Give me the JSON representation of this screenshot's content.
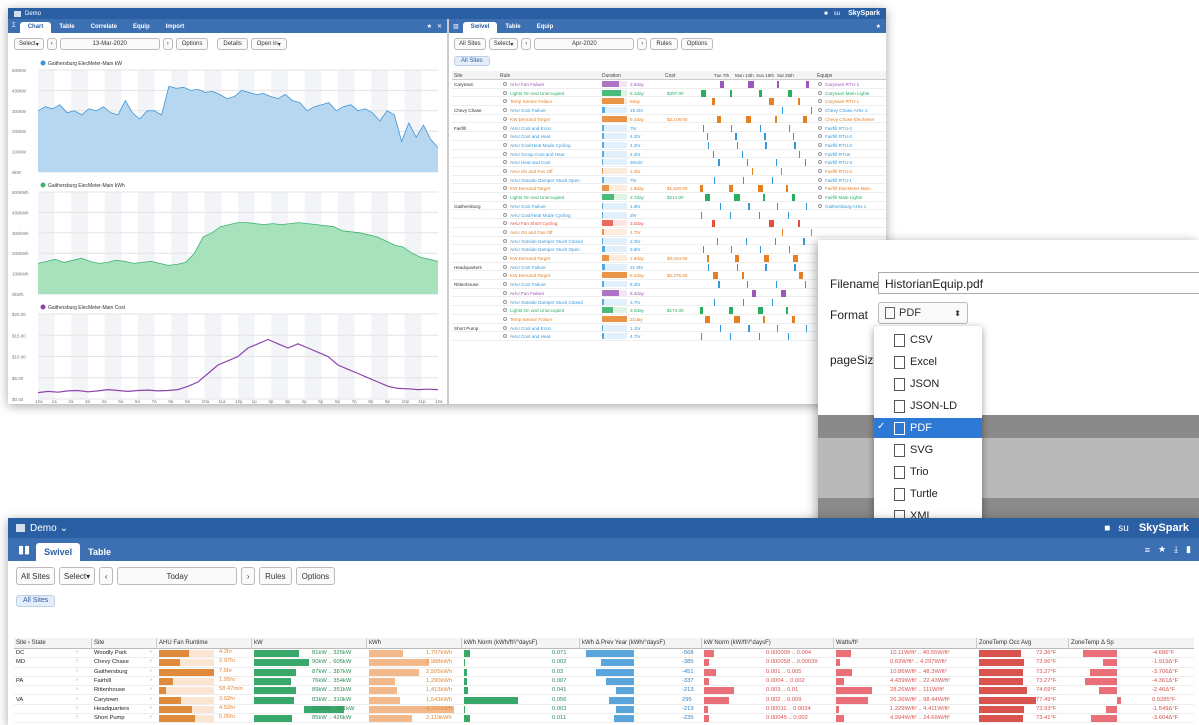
{
  "top": {
    "app_title": "Demo",
    "user": "su",
    "brand": "SkySpark",
    "left_tabs": [
      "Chart",
      "Table",
      "Correlate",
      "Equip",
      "Import"
    ],
    "left_toolbar": {
      "select": "Select",
      "date": "13-Mar-2020",
      "options": "Options",
      "details": "Details",
      "open_in": "Open in"
    },
    "charts": [
      {
        "title": "Gaithersburg ElecMeter-Main kW",
        "color": "#3f95d6",
        "fill": "#b7d6ef",
        "ticks": [
          "500kW",
          "400kW",
          "300kW",
          "200kW",
          "100kW",
          "0kW"
        ],
        "values": [
          300,
          320,
          310,
          330,
          290,
          300,
          280,
          310,
          300,
          320,
          290,
          280,
          350,
          290,
          260,
          300,
          300,
          280,
          420,
          410,
          415,
          400,
          405,
          390,
          395,
          380,
          360,
          370,
          400,
          390,
          380,
          385,
          370,
          360,
          380,
          350,
          340,
          300,
          320,
          330,
          340,
          300,
          320,
          330,
          300,
          310,
          290,
          250,
          300,
          280,
          150,
          240,
          170,
          230,
          160,
          120
        ],
        "max": 500
      },
      {
        "title": "Gaithersburg ElecMeter-Main kWh",
        "color": "#3cb371",
        "fill": "#a8e2bd",
        "ticks": [
          "500kWh",
          "400kWh",
          "300kWh",
          "200kWh",
          "100kWh",
          "0kWh"
        ],
        "values": [
          150,
          160,
          170,
          155,
          165,
          175,
          160,
          150,
          155,
          165,
          160,
          150,
          155,
          160,
          150,
          140,
          145,
          155,
          200,
          280,
          300,
          330,
          340,
          350,
          350,
          345,
          340,
          345,
          340,
          345,
          350,
          345,
          340,
          335,
          330,
          310,
          305,
          300,
          290,
          280,
          260,
          240,
          230,
          200,
          180,
          170,
          160
        ],
        "max": 500
      },
      {
        "title": "Gaithersburg ElecMeter-Main Cost",
        "color": "#8e44ad",
        "fill": "none",
        "ticks": [
          "$20.00",
          "$15.00",
          "$10.00",
          "$5.00",
          "$0.00"
        ],
        "values": [
          1.5,
          1.8,
          1.6,
          1.9,
          2,
          1.7,
          1.9,
          2.2,
          2,
          1.8,
          2,
          2.1,
          1.9,
          2,
          2.2,
          3,
          4,
          6,
          8,
          9,
          10,
          12,
          13,
          14,
          13,
          12,
          13,
          12,
          11,
          10,
          8,
          7,
          6,
          5,
          4,
          3,
          2.5,
          2.4,
          2.2,
          2.3,
          2.2
        ],
        "max": 20
      }
    ],
    "x_ticks": [
      "12a",
      "1a",
      "2a",
      "3a",
      "4a",
      "5a",
      "6a",
      "7a",
      "8a",
      "9a",
      "10a",
      "11a",
      "12p",
      "1p",
      "2p",
      "3p",
      "4p",
      "5p",
      "6p",
      "7p",
      "8p",
      "9p",
      "10p",
      "11p",
      "12a"
    ],
    "right_tabs": [
      "Swivel",
      "Table",
      "Equip"
    ],
    "right_toolbar": {
      "all_sites": "All Sites",
      "select": "Select",
      "date": "Apr-2020",
      "rules": "Rules",
      "options": "Options",
      "chip": "All Sites"
    },
    "rule_headers": [
      "Site",
      "Rule",
      "Duration",
      "Cost",
      "Equips"
    ],
    "timeline_headers": [
      "Tue 7th",
      "Mon 13th",
      "Sun 19th",
      "Sat 25th"
    ],
    "rules": [
      {
        "site": "Carytown",
        "rule": "AHU Fan Failure",
        "dur": "3.8day",
        "cost": "",
        "equip": "Carytown RTU-1",
        "c": "#9b59b6"
      },
      {
        "site": "",
        "rule": "Lights On and Unoccupied",
        "dur": "5.1day",
        "cost": "$397.00",
        "equip": "Carytown Main Lights",
        "c": "#27ae60"
      },
      {
        "site": "",
        "rule": "Temp Sensor Failure",
        "dur": "8day",
        "cost": "",
        "equip": "Carytown RTU-1",
        "c": "#e67e22"
      },
      {
        "site": "Chevy Chase",
        "rule": "AHU Cool Failure",
        "dur": "19.2hr",
        "cost": "",
        "equip": "Chevy Chase AHU-1",
        "c": "#3498db"
      },
      {
        "site": "",
        "rule": "KW Demand Target",
        "dur": "9.4day",
        "cost": "$2,108.00",
        "equip": "Chevy Chase ElecMeter",
        "c": "#e67e22"
      },
      {
        "site": "Fairfill",
        "rule": "AHU Cool and Econ",
        "dur": "7hr",
        "cost": "",
        "equip": "Fairfill RTU-3",
        "c": "#3498db"
      },
      {
        "site": "",
        "rule": "AHU Cool and Heat",
        "dur": "4.2hr",
        "cost": "",
        "equip": "Fairfill RTU-2",
        "c": "#3498db"
      },
      {
        "site": "",
        "rule": "AHU Cool/Heat Mode Cycling",
        "dur": "4.2hr",
        "cost": "",
        "equip": "Fairfill RTU-2",
        "c": "#3498db"
      },
      {
        "site": "",
        "rule": "AHU Group Cool and Heat",
        "dur": "4.2hr",
        "cost": "",
        "equip": "Fairfill RTUs",
        "c": "#3498db"
      },
      {
        "site": "",
        "rule": "AHU Heat and Cool",
        "dur": "30min",
        "cost": "",
        "equip": "Fairfill RTU-3",
        "c": "#3498db"
      },
      {
        "site": "",
        "rule": "AHU On and Fan Off",
        "dur": "1.2hr",
        "cost": "",
        "equip": "Fairfill RTU-2",
        "c": "#e67e22"
      },
      {
        "site": "",
        "rule": "AHU Outside Damper Stuck Open",
        "dur": "7hr",
        "cost": "",
        "equip": "Fairfill RTU-1",
        "c": "#3498db"
      },
      {
        "site": "",
        "rule": "KW Demand Target",
        "dur": "1.8day",
        "cost": "$1,620.00",
        "equip": "Fairfill ElecMeter-Main",
        "c": "#e67e22"
      },
      {
        "site": "",
        "rule": "Lights On and Unoccupied",
        "dur": "3.7day",
        "cost": "$214.00",
        "equip": "Fairfill Main Lights",
        "c": "#27ae60"
      },
      {
        "site": "Gaithersburg",
        "rule": "AHU Cool Failure",
        "dur": "1.8hr",
        "cost": "",
        "equip": "Gaithersburg AHU-1",
        "c": "#3498db"
      },
      {
        "site": "",
        "rule": "AHU Cool/Heat Mode Cycling",
        "dur": "2hr",
        "cost": "",
        "equip": "",
        "c": "#3498db"
      },
      {
        "site": "",
        "rule": "AHU Fan Short Cycling",
        "dur": "3.0day",
        "cost": "",
        "equip": "",
        "c": "#e74c3c"
      },
      {
        "site": "",
        "rule": "AHU On and Fan Off",
        "dur": "4.7hr",
        "cost": "",
        "equip": "",
        "c": "#e67e22"
      },
      {
        "site": "",
        "rule": "AHU Outside Damper Stuck Closed",
        "dur": "2.3hr",
        "cost": "",
        "equip": "",
        "c": "#3498db"
      },
      {
        "site": "",
        "rule": "AHU Outside Damper Stuck Open",
        "dur": "9.8hr",
        "cost": "",
        "equip": "",
        "c": "#3498db"
      },
      {
        "site": "",
        "rule": "KW Demand Target",
        "dur": "1.8day",
        "cost": "$3,024.00",
        "equip": "",
        "c": "#e67e22"
      },
      {
        "site": "Headquarters",
        "rule": "AHU Cool Failure",
        "dur": "21.9hr",
        "cost": "",
        "equip": "",
        "c": "#3498db"
      },
      {
        "site": "",
        "rule": "KW Demand Target",
        "dur": "9.2day",
        "cost": "$2,376.00",
        "equip": "",
        "c": "#e67e22"
      },
      {
        "site": "Rittenhouse",
        "rule": "AHU Cool Failure",
        "dur": "6.3hr",
        "cost": "",
        "equip": "",
        "c": "#3498db"
      },
      {
        "site": "",
        "rule": "AHU Fan Failure",
        "dur": "8.4day",
        "cost": "",
        "equip": "",
        "c": "#9b59b6"
      },
      {
        "site": "",
        "rule": "AHU Outside Damper Stuck Closed",
        "dur": "3.7hr",
        "cost": "",
        "equip": "",
        "c": "#3498db"
      },
      {
        "site": "",
        "rule": "Lights On and Unoccupied",
        "dur": "3.0day",
        "cost": "$174.00",
        "equip": "",
        "c": "#27ae60"
      },
      {
        "site": "",
        "rule": "Temp Sensor Failure",
        "dur": "21day",
        "cost": "",
        "equip": "",
        "c": "#e67e22"
      },
      {
        "site": "Short Pump",
        "rule": "AHU Cool and Econ",
        "dur": "1.1hr",
        "cost": "",
        "equip": "",
        "c": "#3498db"
      },
      {
        "site": "",
        "rule": "AHU Cool and Heat",
        "dur": "4.7hr",
        "cost": "",
        "equip": "",
        "c": "#3498db"
      }
    ]
  },
  "dialog": {
    "filename_label": "Filename",
    "filename_value": "HistorianEquip.pdf",
    "format_label": "Format",
    "format_value": "PDF",
    "pagesize_label": "pageSize",
    "options": [
      "CSV",
      "Excel",
      "JSON",
      "JSON-LD",
      "PDF",
      "SVG",
      "Trio",
      "Turtle",
      "XML",
      "Zinc"
    ],
    "selected": "PDF",
    "check": "✓"
  },
  "bottom": {
    "app_title": "Demo",
    "user": "su",
    "brand": "SkySpark",
    "tabs": [
      "Swivel",
      "Table"
    ],
    "toolbar": {
      "all_sites": "All Sites",
      "select": "Select",
      "date": "Today",
      "rules": "Rules",
      "options": "Options",
      "chip": "All Sites"
    },
    "headers": [
      "Site › State",
      "Site",
      "AHU Fan Runtime",
      "kW",
      "kWh",
      "kWh Norm (kWh/ft²/°daysF)",
      "kWh Δ Prev Year (kWh/°daysF)",
      "kW Norm (kW/ft²/°daysF)",
      "Watts/ft²",
      "ZoneTemp Occ Avg",
      "ZoneTemp Δ Sp"
    ],
    "rows": [
      {
        "state": "DC",
        "site": "Woodly Park",
        "fan": "4.2hr",
        "kw": "81kW .. 325kW",
        "kwh": "1,707kWh",
        "norm": "0.071",
        "delta": "-568",
        "kwn": "0.000099 .. 0.004",
        "watts": "10.11W/ft² .. 40.55W/ft²",
        "occ": "72.36°F",
        "dsp": "-4.686°F"
      },
      {
        "state": "MD",
        "site": "Chevy Chase",
        "fan": "2.97hr",
        "kw": "90kW .. 605kW",
        "kwh": "2,988kWh",
        "norm": "0.002",
        "delta": "-385",
        "kwn": "0.000058 .. 0.00039",
        "watts": "0.63W/ft² .. 4.297W/ft²",
        "occ": "73.96°F",
        "dsp": "-1.919Δ°F"
      },
      {
        "state": "",
        "site": "Gaithersburg",
        "fan": "7.6hr",
        "kw": "87kW .. 387kW",
        "kwh": "2,505kWh",
        "norm": "0.03",
        "delta": "-451",
        "kwn": "0.001 .. 0.005",
        "watts": "10.86W/ft² .. 48.3W/ft²",
        "occ": "73.27°F",
        "dsp": "-3.706Δ°F"
      },
      {
        "state": "PA",
        "site": "Fairhill",
        "fan": "1.95hr",
        "kw": "76kW .. 354kW",
        "kwh": "1,290kWh",
        "norm": "0.007",
        "delta": "-337",
        "kwn": "0.0004 .. 0.002",
        "watts": "4.439W/ft² .. 22.43W/ft²",
        "occ": "73.27°F",
        "dsp": "-4.361Δ°F"
      },
      {
        "state": "",
        "site": "Rittenhouse",
        "fan": "58.47min",
        "kw": "89kW .. 351kW",
        "kwh": "1,413kWh",
        "norm": "0.041",
        "delta": "-213",
        "kwn": "0.003 .. 0.01",
        "watts": "28.26W/ft² .. 111W/ft²",
        "occ": "74.69°F",
        "dsp": "-2.46Δ°F"
      },
      {
        "state": "VA",
        "site": "Carytown",
        "fan": "3.02hr",
        "kw": "83kW .. 310kW",
        "kwh": "1,543kWh",
        "norm": "0.056",
        "delta": "295",
        "kwn": "0.002 .. 0.009",
        "watts": "26.36W/ft² .. 98.44W/ft²",
        "occ": "77.49°F",
        "dsp": "0.5285°F"
      },
      {
        "state": "",
        "site": "Headquarters",
        "fan": "4.52hr",
        "kw": "173kW .. 521kW",
        "kwh": "4,241kWh",
        "norm": "0.003",
        "delta": "-213",
        "kwn": "0.00011 .. 0.0034",
        "watts": "1.229W/ft² .. 4.411W/ft²",
        "occ": "73.93°F",
        "dsp": "-1.549Δ°F"
      },
      {
        "state": "",
        "site": "Short Pump",
        "fan": "5.05hr",
        "kw": "85kW .. 426kW",
        "kwh": "2,119kWh",
        "norm": "0.011",
        "delta": "-235",
        "kwn": "0.00045 .. 0.002",
        "watts": "4.994W/ft² .. 24.69W/ft²",
        "occ": "73.41°F",
        "dsp": "-3.604Δ°F"
      }
    ]
  }
}
